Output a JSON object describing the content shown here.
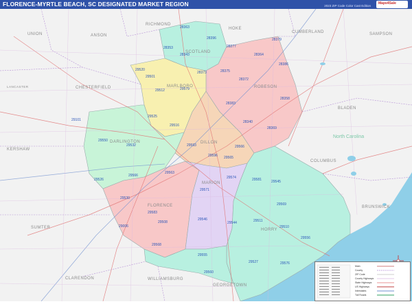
{
  "header": {
    "title": "FLORENCE-MYRTLE BEACH, SC DESIGNATED MARKET REGION",
    "edition": "2023 ZIP Code Color Cast Edition",
    "logo_text": "Maps4Sale"
  },
  "map": {
    "water_color": "#8fcfe8",
    "land_color": "#f2f2f2",
    "region_colors": {
      "teal": "#b8f0e0",
      "pink": "#f8c8c8",
      "yellow": "#f8f0b0",
      "peach": "#f6d6b8",
      "lavender": "#e2d4f4",
      "mint": "#c8f4d8"
    },
    "county_labels": [
      "RICHMOND",
      "SCOTLAND",
      "HOKE",
      "CUMBERLAND",
      "SAMPSON",
      "UNION",
      "ANSON",
      "CHESTERFIELD",
      "MARLBORO",
      "ROBESON",
      "BLADEN",
      "LANCASTER",
      "KERSHAW",
      "DARLINGTON",
      "DILLON",
      "COLUMBUS",
      "FLORENCE",
      "MARION",
      "HORRY",
      "BRUNSWICK",
      "SUMTER",
      "CLARENDON",
      "WILLIAMSBURG",
      "GEORGETOWN",
      "North Carolina"
    ],
    "zip_labels": [
      "28363",
      "28396",
      "28353",
      "28343",
      "28277",
      "28379",
      "28364",
      "28375",
      "28386",
      "28373",
      "28372",
      "28383",
      "28358",
      "28340",
      "28369",
      "29520",
      "29579",
      "29512",
      "29525",
      "29501",
      "29596",
      "29516",
      "29101",
      "29550",
      "29532",
      "29593",
      "29566",
      "29565",
      "29563",
      "29571",
      "29574",
      "29581",
      "29545",
      "29526",
      "29569",
      "29566",
      "29530",
      "29583",
      "29546",
      "29544",
      "29511",
      "29556",
      "29527",
      "29576",
      "29568",
      "29555",
      "29560",
      "29006",
      "29508",
      "29510"
    ]
  },
  "legend": {
    "items": [
      "Main",
      "County",
      "ZIP Code",
      "County Highways",
      "State Highways",
      "US Highways",
      "Interstates",
      "Toll Roads"
    ]
  }
}
